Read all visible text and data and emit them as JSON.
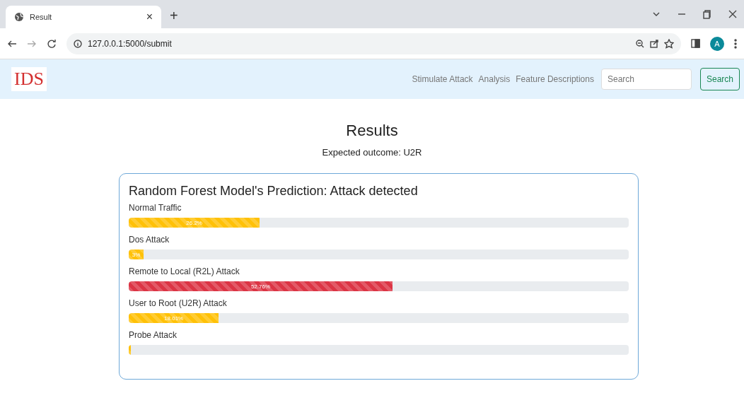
{
  "browser": {
    "tab_title": "Result",
    "tab_close": "×",
    "new_tab": "+",
    "url": "127.0.0.1:5000/submit",
    "profile_initial": "A"
  },
  "navbar": {
    "brand": "IDS",
    "links": [
      "Stimulate Attack",
      "Analysis",
      "Feature Descriptions"
    ],
    "search": {
      "placeholder": "Search"
    },
    "search_button": "Search"
  },
  "heading": "Results",
  "expected": "Expected outcome: U2R",
  "card": {
    "title": "Random Forest Model's Prediction: Attack detected",
    "bars": [
      {
        "label": "Normal Traffic",
        "level": 0.262,
        "reading": "26.2%",
        "color": "#ffc107"
      },
      {
        "label": "Dos Attack",
        "level": 0.03,
        "reading": "3%",
        "color": "#ffc107"
      },
      {
        "label": "Remote to Local (R2L) Attack",
        "level": 0.5276,
        "reading": "52.76%",
        "color": "#dc3545"
      },
      {
        "label": "User to Root (U2R) Attack",
        "level": 0.1801,
        "reading": "18.01%",
        "color": "#ffc107"
      },
      {
        "label": "Probe Attack",
        "level": 0.002,
        "color": "#ffc107"
      }
    ]
  }
}
